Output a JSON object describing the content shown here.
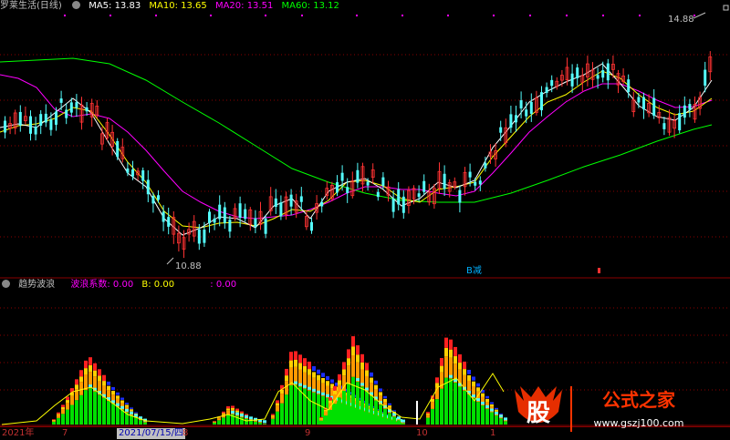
{
  "header": {
    "title": "罗莱生活(日线)",
    "ma5_label": "MA5: 13.83",
    "ma10_label": "MA10: 13.65",
    "ma20_label": "MA20: 13.51",
    "ma60_label": "MA60: 13.12"
  },
  "price": {
    "high_label": "14.88",
    "low_label": "10.88",
    "signal_label": "B减"
  },
  "indicator": {
    "name": "趋势波浪",
    "coef_label": "波浪系数: 0.00",
    "b_label": "B: 0.00",
    "extra_label": ": 0.00"
  },
  "dates": {
    "year": "2021年",
    "m7": "7",
    "selected": "2021/07/15/四",
    "m8": "8",
    "m9": "9",
    "m10": "10",
    "m11": "1"
  },
  "watermark": {
    "big": "股",
    "name": "公式之家",
    "url": "www.gszj100.com"
  },
  "colors": {
    "up": "#ff3232",
    "down": "#54fcfc",
    "ma5": "#ffffff",
    "ma10": "#ffff00",
    "ma20": "#ff00ff",
    "ma60": "#00ff00",
    "grid": "#8a0000"
  }
}
